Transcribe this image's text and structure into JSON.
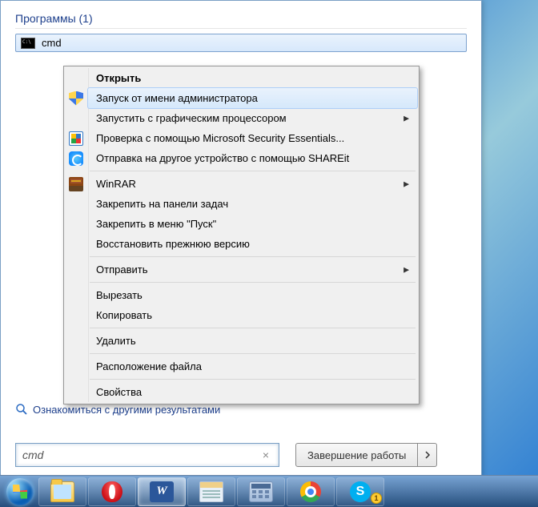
{
  "start": {
    "section_title": "Программы (1)",
    "result_label": "cmd",
    "see_more": "Ознакомиться с другими результатами",
    "search_value": "cmd",
    "shutdown_label": "Завершение работы"
  },
  "context_menu": {
    "open": "Открыть",
    "run_as_admin": "Запуск от имени администратора",
    "run_gpu": "Запустить с графическим процессором",
    "mse_scan": "Проверка с помощью Microsoft Security Essentials...",
    "shareit": "Отправка на другое устройство с помощью SHAREit",
    "winrar": "WinRAR",
    "pin_taskbar": "Закрепить на панели задач",
    "pin_start": "Закрепить в меню \"Пуск\"",
    "restore_prev": "Восстановить прежнюю версию",
    "send_to": "Отправить",
    "cut": "Вырезать",
    "copy": "Копировать",
    "delete": "Удалить",
    "open_location": "Расположение файла",
    "properties": "Свойства"
  },
  "taskbar": {
    "word_letter": "W",
    "skype_letter": "S",
    "skype_badge": "1"
  }
}
